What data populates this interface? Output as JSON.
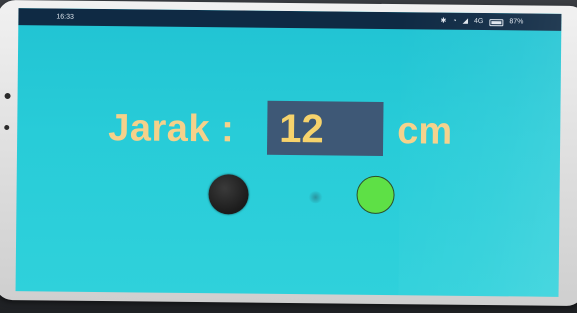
{
  "status_bar": {
    "time": "16:33",
    "signal": "4G",
    "battery_percent": "87%",
    "battery_level": 0.87
  },
  "reading": {
    "label": "Jarak :",
    "value": "12",
    "unit": "cm"
  },
  "indicators": [
    {
      "name": "black-indicator",
      "color": "#1b1b1b"
    },
    {
      "name": "green-indicator",
      "color": "#5ee046"
    }
  ],
  "colors": {
    "screen_background": "#28ccd8",
    "label_text": "#f5d18a",
    "value_box": "#3e5876",
    "value_text": "#f6d36c",
    "status_bar": "#0f2a44"
  }
}
